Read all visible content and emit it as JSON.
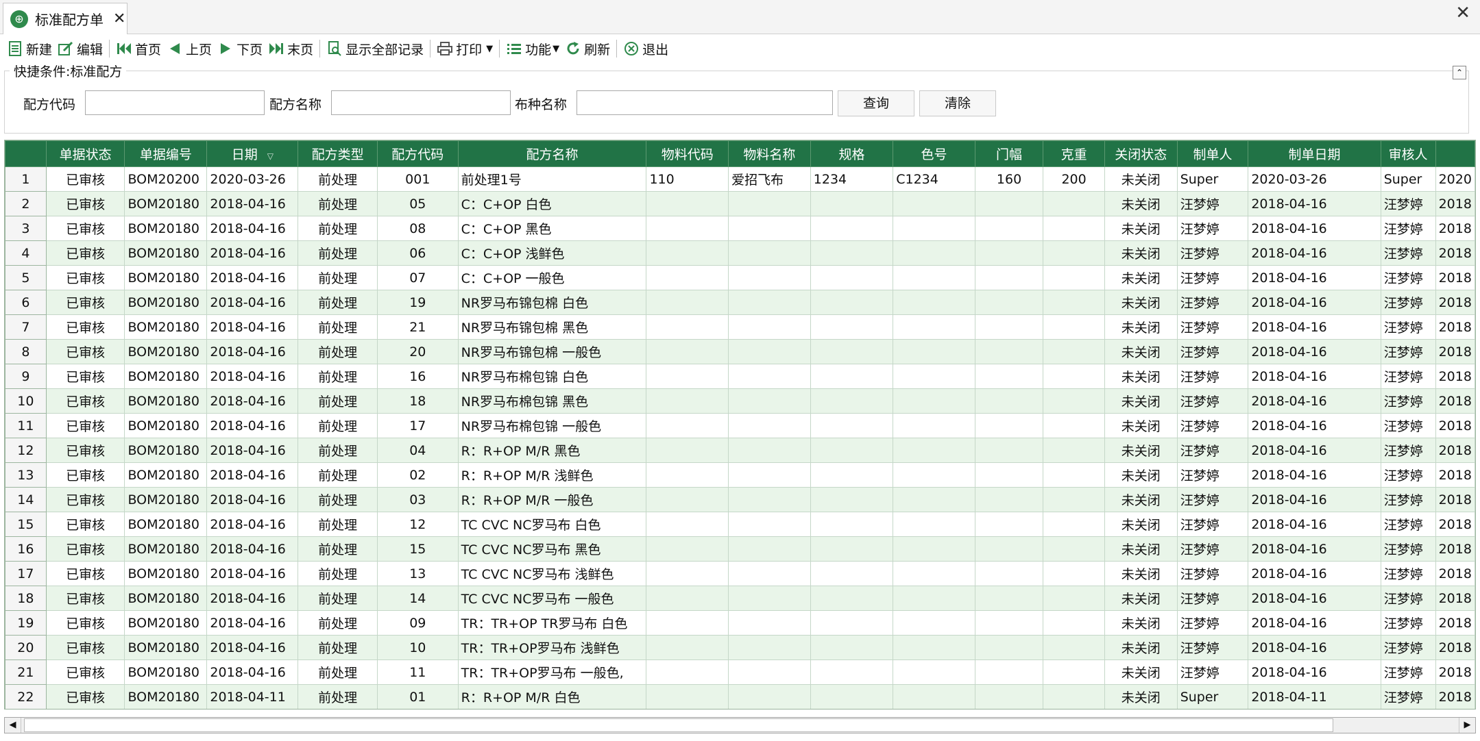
{
  "tab": {
    "title": "标准配方单",
    "close": "✕"
  },
  "window": {
    "close": "✕"
  },
  "toolbar": {
    "new": "新建",
    "edit": "编辑",
    "first": "首页",
    "prev": "上页",
    "next": "下页",
    "last": "末页",
    "show_all": "显示全部记录",
    "print": "打印",
    "function": "功能",
    "refresh": "刷新",
    "exit": "退出"
  },
  "filter": {
    "legend": "快捷条件:标准配方",
    "formula_code_label": "配方代码",
    "formula_code_value": "",
    "formula_name_label": "配方名称",
    "formula_name_value": "",
    "fabric_name_label": "布种名称",
    "fabric_name_value": "",
    "query_button": "查询",
    "clear_button": "清除"
  },
  "grid": {
    "columns": [
      "",
      "单据状态",
      "单据编号",
      "日期",
      "配方类型",
      "配方代码",
      "配方名称",
      "物料代码",
      "物料名称",
      "规格",
      "色号",
      "门幅",
      "克重",
      "关闭状态",
      "制单人",
      "制单日期",
      "审核人"
    ],
    "rows": [
      [
        "1",
        "已审核",
        "BOM20200",
        "2020-03-26",
        "前处理",
        "001",
        "前处理1号",
        "110",
        "爱招飞布",
        "1234",
        "C1234",
        "160",
        "200",
        "未关闭",
        "Super",
        "2020-03-26",
        "Super",
        "2020"
      ],
      [
        "2",
        "已审核",
        "BOM20180",
        "2018-04-16",
        "前处理",
        "05",
        "C：C+OP 白色",
        "",
        "",
        "",
        "",
        "",
        "",
        "未关闭",
        "汪梦婷",
        "2018-04-16",
        "汪梦婷",
        "2018"
      ],
      [
        "3",
        "已审核",
        "BOM20180",
        "2018-04-16",
        "前处理",
        "08",
        "C：C+OP 黑色",
        "",
        "",
        "",
        "",
        "",
        "",
        "未关闭",
        "汪梦婷",
        "2018-04-16",
        "汪梦婷",
        "2018"
      ],
      [
        "4",
        "已审核",
        "BOM20180",
        "2018-04-16",
        "前处理",
        "06",
        "C：C+OP 浅鲜色",
        "",
        "",
        "",
        "",
        "",
        "",
        "未关闭",
        "汪梦婷",
        "2018-04-16",
        "汪梦婷",
        "2018"
      ],
      [
        "5",
        "已审核",
        "BOM20180",
        "2018-04-16",
        "前处理",
        "07",
        "C：C+OP 一般色",
        "",
        "",
        "",
        "",
        "",
        "",
        "未关闭",
        "汪梦婷",
        "2018-04-16",
        "汪梦婷",
        "2018"
      ],
      [
        "6",
        "已审核",
        "BOM20180",
        "2018-04-16",
        "前处理",
        "19",
        "NR罗马布锦包棉 白色",
        "",
        "",
        "",
        "",
        "",
        "",
        "未关闭",
        "汪梦婷",
        "2018-04-16",
        "汪梦婷",
        "2018"
      ],
      [
        "7",
        "已审核",
        "BOM20180",
        "2018-04-16",
        "前处理",
        "21",
        "NR罗马布锦包棉 黑色",
        "",
        "",
        "",
        "",
        "",
        "",
        "未关闭",
        "汪梦婷",
        "2018-04-16",
        "汪梦婷",
        "2018"
      ],
      [
        "8",
        "已审核",
        "BOM20180",
        "2018-04-16",
        "前处理",
        "20",
        "NR罗马布锦包棉 一般色",
        "",
        "",
        "",
        "",
        "",
        "",
        "未关闭",
        "汪梦婷",
        "2018-04-16",
        "汪梦婷",
        "2018"
      ],
      [
        "9",
        "已审核",
        "BOM20180",
        "2018-04-16",
        "前处理",
        "16",
        "NR罗马布棉包锦 白色",
        "",
        "",
        "",
        "",
        "",
        "",
        "未关闭",
        "汪梦婷",
        "2018-04-16",
        "汪梦婷",
        "2018"
      ],
      [
        "10",
        "已审核",
        "BOM20180",
        "2018-04-16",
        "前处理",
        "18",
        "NR罗马布棉包锦 黑色",
        "",
        "",
        "",
        "",
        "",
        "",
        "未关闭",
        "汪梦婷",
        "2018-04-16",
        "汪梦婷",
        "2018"
      ],
      [
        "11",
        "已审核",
        "BOM20180",
        "2018-04-16",
        "前处理",
        "17",
        "NR罗马布棉包锦 一般色",
        "",
        "",
        "",
        "",
        "",
        "",
        "未关闭",
        "汪梦婷",
        "2018-04-16",
        "汪梦婷",
        "2018"
      ],
      [
        "12",
        "已审核",
        "BOM20180",
        "2018-04-16",
        "前处理",
        "04",
        "R：R+OP M/R 黑色",
        "",
        "",
        "",
        "",
        "",
        "",
        "未关闭",
        "汪梦婷",
        "2018-04-16",
        "汪梦婷",
        "2018"
      ],
      [
        "13",
        "已审核",
        "BOM20180",
        "2018-04-16",
        "前处理",
        "02",
        "R：R+OP M/R 浅鲜色",
        "",
        "",
        "",
        "",
        "",
        "",
        "未关闭",
        "汪梦婷",
        "2018-04-16",
        "汪梦婷",
        "2018"
      ],
      [
        "14",
        "已审核",
        "BOM20180",
        "2018-04-16",
        "前处理",
        "03",
        "R：R+OP M/R 一般色",
        "",
        "",
        "",
        "",
        "",
        "",
        "未关闭",
        "汪梦婷",
        "2018-04-16",
        "汪梦婷",
        "2018"
      ],
      [
        "15",
        "已审核",
        "BOM20180",
        "2018-04-16",
        "前处理",
        "12",
        "TC CVC NC罗马布 白色",
        "",
        "",
        "",
        "",
        "",
        "",
        "未关闭",
        "汪梦婷",
        "2018-04-16",
        "汪梦婷",
        "2018"
      ],
      [
        "16",
        "已审核",
        "BOM20180",
        "2018-04-16",
        "前处理",
        "15",
        "TC CVC NC罗马布 黑色",
        "",
        "",
        "",
        "",
        "",
        "",
        "未关闭",
        "汪梦婷",
        "2018-04-16",
        "汪梦婷",
        "2018"
      ],
      [
        "17",
        "已审核",
        "BOM20180",
        "2018-04-16",
        "前处理",
        "13",
        "TC CVC NC罗马布 浅鲜色",
        "",
        "",
        "",
        "",
        "",
        "",
        "未关闭",
        "汪梦婷",
        "2018-04-16",
        "汪梦婷",
        "2018"
      ],
      [
        "18",
        "已审核",
        "BOM20180",
        "2018-04-16",
        "前处理",
        "14",
        "TC CVC NC罗马布 一般色",
        "",
        "",
        "",
        "",
        "",
        "",
        "未关闭",
        "汪梦婷",
        "2018-04-16",
        "汪梦婷",
        "2018"
      ],
      [
        "19",
        "已审核",
        "BOM20180",
        "2018-04-16",
        "前处理",
        "09",
        "TR：TR+OP TR罗马布 白色",
        "",
        "",
        "",
        "",
        "",
        "",
        "未关闭",
        "汪梦婷",
        "2018-04-16",
        "汪梦婷",
        "2018"
      ],
      [
        "20",
        "已审核",
        "BOM20180",
        "2018-04-16",
        "前处理",
        "10",
        "TR：TR+OP罗马布 浅鲜色",
        "",
        "",
        "",
        "",
        "",
        "",
        "未关闭",
        "汪梦婷",
        "2018-04-16",
        "汪梦婷",
        "2018"
      ],
      [
        "21",
        "已审核",
        "BOM20180",
        "2018-04-16",
        "前处理",
        "11",
        "TR：TR+OP罗马布 一般色,",
        "",
        "",
        "",
        "",
        "",
        "",
        "未关闭",
        "汪梦婷",
        "2018-04-16",
        "汪梦婷",
        "2018"
      ],
      [
        "22",
        "已审核",
        "BOM20180",
        "2018-04-11",
        "前处理",
        "01",
        "R：R+OP M/R 白色",
        "",
        "",
        "",
        "",
        "",
        "",
        "未关闭",
        "Super",
        "2018-04-11",
        "汪梦婷",
        "2018"
      ]
    ]
  },
  "scrollbar": {
    "left": "◀",
    "right": "▶"
  },
  "colors": {
    "header_green": "#217346",
    "row_alt": "#e9f5e9",
    "accent_green": "#2f8a4c"
  }
}
